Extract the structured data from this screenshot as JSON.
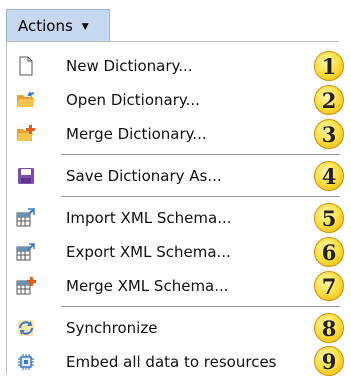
{
  "header": {
    "actions_label": "Actions"
  },
  "menu": {
    "items": [
      {
        "label": "New Dictionary...",
        "badge": "1",
        "icon": "new-document-icon"
      },
      {
        "label": "Open Dictionary...",
        "badge": "2",
        "icon": "open-folder-icon"
      },
      {
        "label": "Merge Dictionary...",
        "badge": "3",
        "icon": "merge-folder-icon"
      },
      {
        "label": "Save Dictionary As...",
        "badge": "4",
        "icon": "save-disk-icon"
      },
      {
        "label": "Import XML Schema...",
        "badge": "5",
        "icon": "import-schema-icon"
      },
      {
        "label": "Export XML Schema...",
        "badge": "6",
        "icon": "export-schema-icon"
      },
      {
        "label": "Merge XML Schema...",
        "badge": "7",
        "icon": "merge-schema-icon"
      },
      {
        "label": "Synchronize",
        "badge": "8",
        "icon": "synchronize-icon"
      },
      {
        "label": "Embed all data to resources",
        "badge": "9",
        "icon": "embed-resources-icon"
      }
    ]
  },
  "colors": {
    "header_bg": "#c5d8ef",
    "badge_fill": "#ffe14a",
    "folder": "#f2b233",
    "save": "#7b4fa8",
    "accent_blue": "#3a78c8"
  }
}
